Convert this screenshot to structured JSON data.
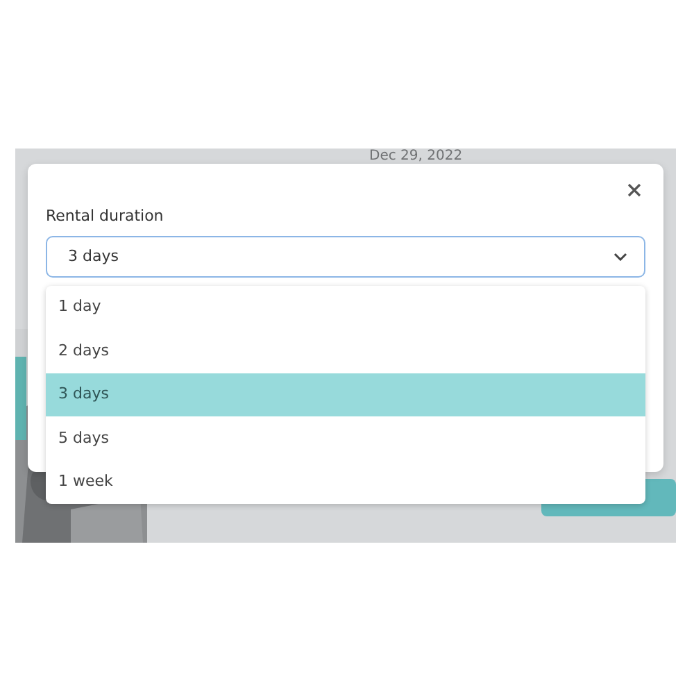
{
  "background": {
    "date": "Dec 29, 2022"
  },
  "modal": {
    "label": "Rental duration",
    "select": {
      "value": "3 days",
      "expanded": true
    },
    "options": [
      {
        "label": "1 day",
        "selected": false
      },
      {
        "label": "2 days",
        "selected": false
      },
      {
        "label": "3 days",
        "selected": true
      },
      {
        "label": "5 days",
        "selected": false
      },
      {
        "label": "1 week",
        "selected": false
      }
    ]
  }
}
